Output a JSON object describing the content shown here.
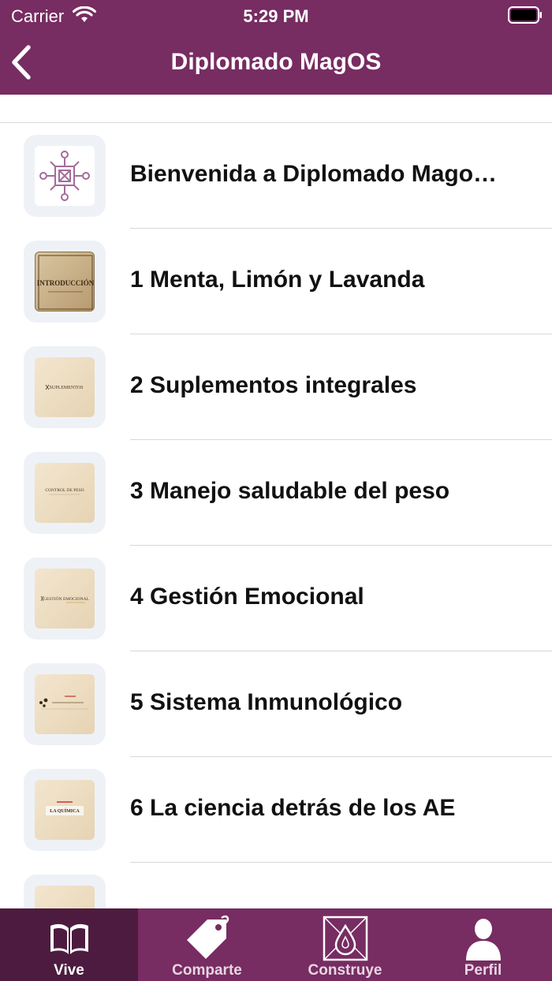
{
  "status_bar": {
    "carrier": "Carrier",
    "time": "5:29 PM",
    "wifi_icon": "wifi-icon",
    "battery_icon": "battery-icon"
  },
  "nav": {
    "title": "Diplomado MagOS",
    "back_icon": "chevron-left-icon"
  },
  "colors": {
    "brand": "#772c62",
    "brand_dark": "#4d1b3f",
    "divider": "#d8d8d8",
    "thumb_frame": "#eef2f7"
  },
  "items": [
    {
      "label": "Bienvenida a Diplomado Mago…",
      "thumb": "logo"
    },
    {
      "label": "1 Menta, Limón y Lavanda",
      "thumb": "introduccion",
      "thumb_text": "INTRODUCCIÓN"
    },
    {
      "label": "2 Suplementos integrales",
      "thumb": "parchment",
      "thumb_text": "SUPLEMENTOS"
    },
    {
      "label": "3 Manejo saludable del peso",
      "thumb": "parchment",
      "thumb_text": "CONTROL DE PESO"
    },
    {
      "label": "4 Gestión Emocional",
      "thumb": "parchment",
      "thumb_text": "GESTIÓN EMOCIONAL"
    },
    {
      "label": "5 Sistema Inmunológico",
      "thumb": "parchment"
    },
    {
      "label": "6 La ciencia detrás de los AE",
      "thumb": "parchment",
      "thumb_text": "LA QUÍMICA"
    },
    {
      "label": "",
      "thumb": "parchment"
    }
  ],
  "tabs": [
    {
      "label": "Vive",
      "icon": "book-icon",
      "active": true
    },
    {
      "label": "Comparte",
      "icon": "tag-icon",
      "active": false
    },
    {
      "label": "Construye",
      "icon": "drop-frame-icon",
      "active": false
    },
    {
      "label": "Perfil",
      "icon": "person-icon",
      "active": false
    }
  ]
}
